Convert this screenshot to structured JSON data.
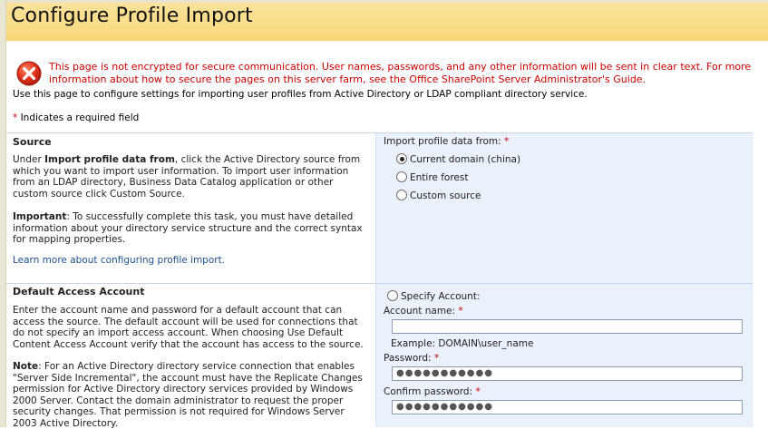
{
  "page": {
    "title": "Configure Profile Import",
    "warning": "This page is not encrypted for secure communication. User names, passwords, and any other information will be sent in clear text. For more information about how to secure the pages on this server farm, see the Office SharePoint Server Administrator's Guide.",
    "intro": "Use this page to configure settings for importing user profiles from Active Directory or LDAP compliant directory service.",
    "required_star": "*",
    "required_note": " Indicates a required field"
  },
  "source": {
    "title": "Source",
    "p1_prefix": "Under ",
    "p1_bold": "Import profile data from",
    "p1_rest": ", click the Active Directory source from which you want to import user information. To import user information from an LDAP directory, Business Data Catalog application or other custom source click Custom Source.",
    "p2_bold": "Important",
    "p2_rest": ": To successfully complete this task, you must have detailed information about your directory service structure and the correct syntax for mapping properties.",
    "link": "Learn more about configuring profile import.",
    "field_label": "Import profile data from:",
    "options": [
      {
        "label": "Current domain (china)",
        "selected": true
      },
      {
        "label": "Entire forest",
        "selected": false
      },
      {
        "label": "Custom source",
        "selected": false
      }
    ]
  },
  "access": {
    "title": "Default Access Account",
    "p1": "Enter the account name and password for a default account that can access the source. The default account will be used for connections that do not specify an import access account. When choosing Use Default Content Access Account verify that the account has access to the source.",
    "p2_bold": "Note",
    "p2_rest": ": For an Active Directory directory service connection that enables \"Server Side Incremental\", the account must have the Replicate Changes permission for Active Directory directory services provided by Windows 2000 Server. Contact the domain administrator to request the proper security changes. That permission is not required for Windows Server 2003 Active Directory.",
    "specify_label": "Specify Account:",
    "account_label": "Account name:",
    "account_value": "",
    "example": "Example: DOMAIN\\user_name",
    "password_label": "Password:",
    "password_value": "●●●●●●●●●●●",
    "confirm_label": "Confirm password:",
    "confirm_value": "●●●●●●●●●●●"
  },
  "colors": {
    "title_band": "#f8d879",
    "warning_text": "#cc0000",
    "right_panel": "#eaf1fa",
    "link": "#1d4f91"
  }
}
